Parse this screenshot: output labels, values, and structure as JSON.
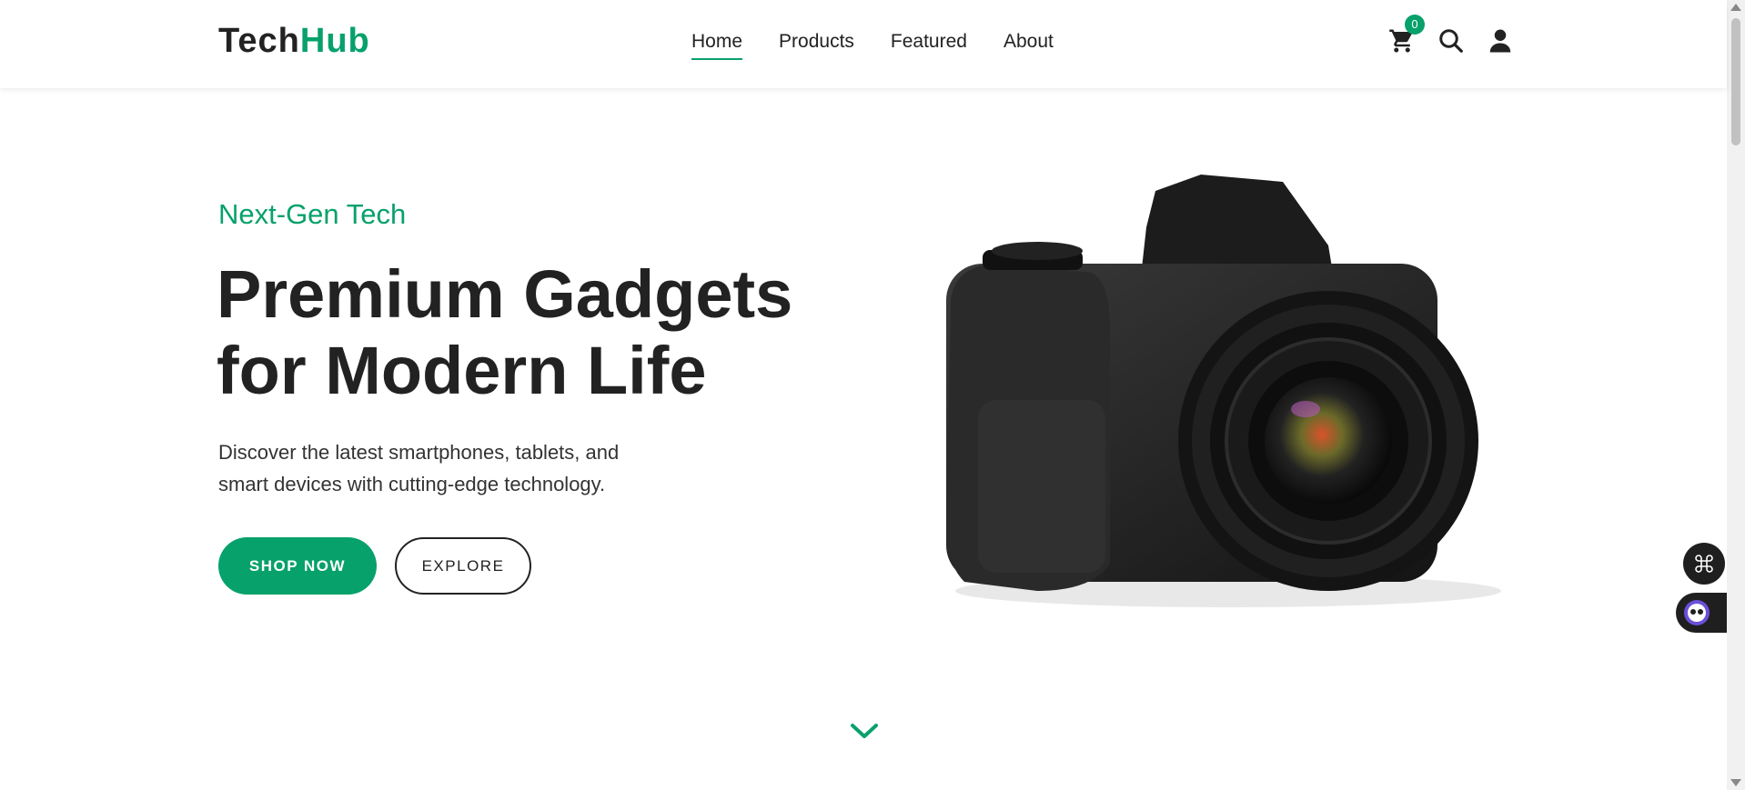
{
  "brand": {
    "name_part1": "Tech",
    "name_part2": "Hub"
  },
  "nav": {
    "items": [
      {
        "label": "Home",
        "active": true
      },
      {
        "label": "Products",
        "active": false
      },
      {
        "label": "Featured",
        "active": false
      },
      {
        "label": "About",
        "active": false
      }
    ]
  },
  "header_icons": {
    "cart_icon": "cart-icon",
    "cart_count": "0",
    "search_icon": "search-icon",
    "user_icon": "user-icon"
  },
  "hero": {
    "eyebrow": "Next-Gen Tech",
    "headline_line1": "Premium Gadgets",
    "headline_line2": "for Modern Life",
    "subtext_line1": "Discover the latest smartphones, tablets, and",
    "subtext_line2": "smart devices with cutting-edge technology.",
    "primary_button": "SHOP NOW",
    "secondary_button": "EXPLORE",
    "image": "camera-image"
  },
  "colors": {
    "accent": "#07a16b",
    "text": "#222222",
    "widget_bg": "#1f1f1f"
  },
  "widgets": {
    "fab_icon": "command-icon",
    "assistant_icon": "assistant-icon"
  }
}
